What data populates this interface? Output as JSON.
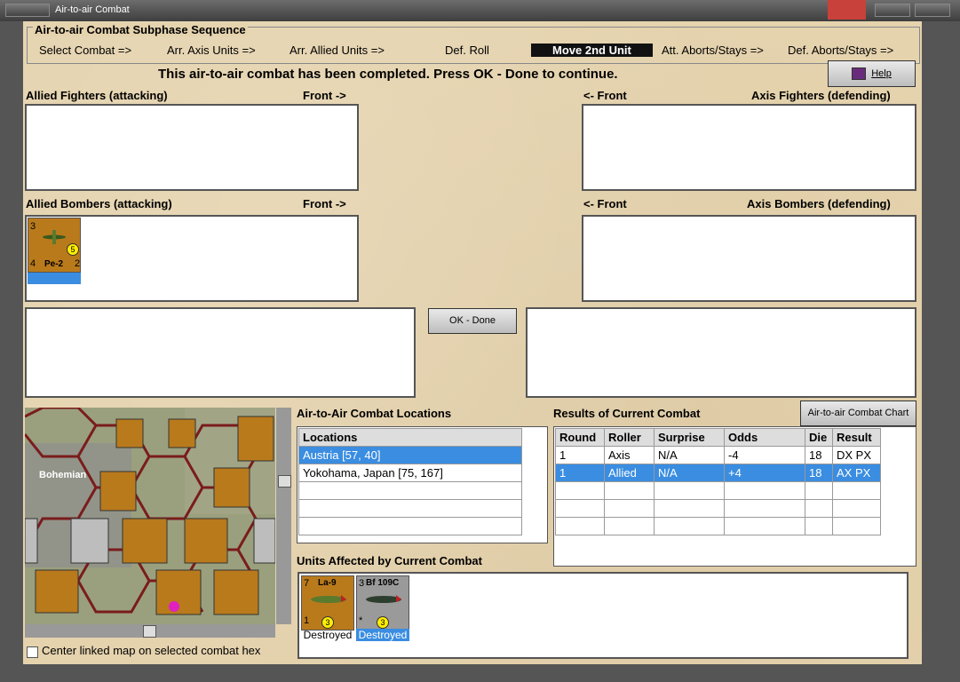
{
  "window": {
    "title": "Air-to-air Combat"
  },
  "sequence": {
    "title": "Air-to-air Combat Subphase Sequence",
    "steps": [
      "Select Combat =>",
      "Arr. Axis Units =>",
      "Arr. Allied Units =>",
      "Def. Roll",
      "Move 2nd Unit",
      "Att. Aborts/Stays =>",
      "Def. Aborts/Stays =>"
    ],
    "active_index": 4
  },
  "message": "This air-to-air combat has been completed.  Press OK - Done to continue.",
  "help_label": "Help",
  "panels": {
    "allied_fighters": "Allied Fighters (attacking)",
    "front_right_1": "Front ->",
    "axis_front_1": "<- Front",
    "axis_fighters": "Axis Fighters (defending)",
    "allied_bombers": "Allied Bombers (attacking)",
    "front_right_2": "Front ->",
    "axis_front_2": "<- Front",
    "axis_bombers": "Axis Bombers (defending)"
  },
  "bomber_counter": {
    "name": "Pe-2",
    "attack": "3",
    "defense": "4",
    "range": "2",
    "circle": "5"
  },
  "ok_done_label": "OK - Done",
  "locations": {
    "title": "Air-to-Air Combat Locations",
    "header": "Locations",
    "rows": [
      "Austria [57, 40]",
      "Yokohama, Japan [75, 167]",
      "",
      "",
      ""
    ],
    "selected": 0
  },
  "results": {
    "title": "Results of Current Combat",
    "chart_button": "Air-to-air Combat Chart",
    "headers": [
      "Round",
      "Roller",
      "Surprise",
      "Odds",
      "Die",
      "Result"
    ],
    "rows": [
      [
        "1",
        "Axis",
        "N/A",
        "-4",
        "18",
        "DX PX"
      ],
      [
        "1",
        "Allied",
        "N/A",
        "+4",
        "18",
        "AX PX"
      ],
      [
        "",
        "",
        "",
        "",
        "",
        ""
      ],
      [
        "",
        "",
        "",
        "",
        "",
        ""
      ],
      [
        "",
        "",
        "",
        "",
        "",
        ""
      ]
    ],
    "selected": 1
  },
  "affected": {
    "title": "Units Affected by Current Combat",
    "units": [
      {
        "name": "La-9",
        "top": "7",
        "bottom": "1",
        "circle": "3",
        "status": "Destroyed"
      },
      {
        "name": "Bf 109C",
        "top": "3",
        "bottom": "*",
        "circle": "3",
        "status": "Destroyed"
      }
    ]
  },
  "map": {
    "region_label": "Bohemian",
    "center_label": "Center linked map on selected combat hex"
  },
  "colors": {
    "client_bg": "#e5d3ae",
    "selection": "#3a8de0",
    "counter_brown": "#b97a1c"
  }
}
